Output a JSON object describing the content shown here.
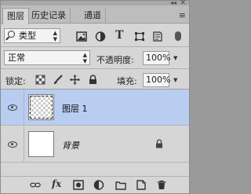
{
  "panel": {
    "collapse_glyph": "◂◂",
    "close_glyph": "✕",
    "menu_glyph": "≡"
  },
  "tabs": [
    {
      "label": "图层",
      "active": true
    },
    {
      "label": "历史记录",
      "active": false
    },
    {
      "label": "通道",
      "active": false
    }
  ],
  "filter": {
    "kind_label": "类型",
    "icons": [
      "image-filter-icon",
      "adjustment-filter-icon",
      "type-filter-icon",
      "shape-filter-icon",
      "smart-object-filter-icon"
    ],
    "type_glyph": "T"
  },
  "blend": {
    "mode": "正常",
    "opacity_label": "不透明度:",
    "opacity_value": "100%"
  },
  "lock": {
    "label": "锁定:",
    "icons": [
      "lock-transparent-icon",
      "lock-image-icon",
      "lock-position-icon",
      "lock-all-icon"
    ],
    "fill_label": "填充:",
    "fill_value": "100%"
  },
  "layers": [
    {
      "name": "图层 1",
      "selected": true,
      "visible": true,
      "transparent": true,
      "locked": false
    },
    {
      "name": "背景",
      "selected": false,
      "visible": true,
      "transparent": false,
      "locked": true
    }
  ],
  "bottom_toolbar": {
    "fx_label": "fx",
    "icons": [
      "link-layers-icon",
      "add-style-icon",
      "add-mask-icon",
      "new-adjustment-icon",
      "new-group-icon",
      "new-layer-icon",
      "delete-layer-icon"
    ]
  },
  "colors": {
    "panel_bg": "#d6d6d6",
    "selected_layer": "#b9cdf1"
  }
}
